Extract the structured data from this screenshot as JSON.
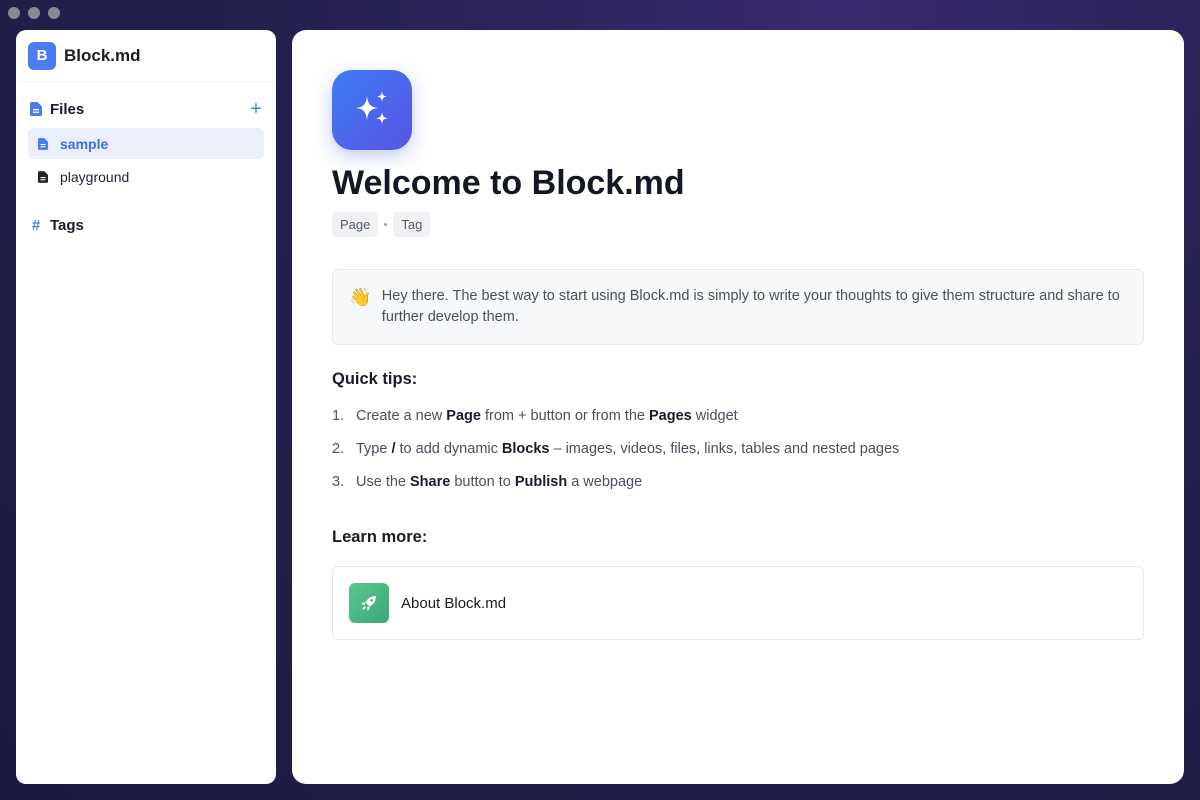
{
  "app": {
    "name": "Block.md",
    "logo_letter": "B"
  },
  "sidebar": {
    "files_section": {
      "label": "Files",
      "add_icon": "plus-icon"
    },
    "files": [
      {
        "label": "sample",
        "active": true
      },
      {
        "label": "playground",
        "active": false
      }
    ],
    "tags_section": {
      "label": "Tags"
    }
  },
  "page": {
    "icon": "sparkles-icon",
    "title": "Welcome to Block.md",
    "chips": [
      "Page",
      "Tag"
    ],
    "callout": {
      "emoji": "👋",
      "text": "Hey there. The best way to start using Block.md is simply to write your thoughts to give them structure and share to further develop them."
    },
    "quick_tips_heading": "Quick tips:",
    "tips": [
      {
        "num": "1.",
        "parts": [
          "Create a new ",
          "Page",
          " from + button or from the ",
          "Pages",
          " widget"
        ]
      },
      {
        "num": "2.",
        "parts": [
          "Type ",
          "/",
          " to add dynamic ",
          "Blocks",
          " – images, videos, files, links, tables and nested pages"
        ]
      },
      {
        "num": "3.",
        "parts": [
          "Use the ",
          "Share",
          " button to ",
          "Publish",
          " a webpage"
        ]
      }
    ],
    "learn_more_heading": "Learn more:",
    "learn_more_link": {
      "label": "About Block.md",
      "icon": "rocket-icon"
    }
  },
  "colors": {
    "accent": "#4b7cf0",
    "active_bg": "#e9effb",
    "hero_gradient": [
      "#3b7bf5",
      "#5a54e2"
    ],
    "link_icon_gradient": [
      "#5cc68d",
      "#3aa978"
    ]
  }
}
